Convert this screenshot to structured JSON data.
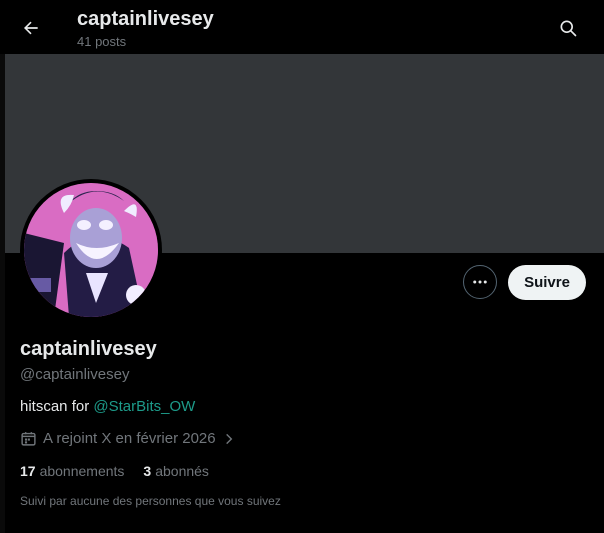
{
  "header": {
    "title": "captainlivesey",
    "subtitle": "41 posts",
    "back_icon": "arrow-left-icon",
    "search_icon": "search-icon"
  },
  "banner": {
    "color": "#333639"
  },
  "profile": {
    "display_name": "captainlivesey",
    "handle": "@captainlivesey",
    "bio_prefix": "hitscan for ",
    "bio_link": "@StarBits_OW",
    "joined": "A rejoint X en février 2026",
    "following_count": "17",
    "following_label": "abonnements",
    "followers_count": "3",
    "followers_label": "abonnés",
    "followed_by": "Suivi par aucune des personnes que vous suivez"
  },
  "actions": {
    "more_icon": "more-dots-icon",
    "follow_label": "Suivre"
  },
  "colors": {
    "background": "#000000",
    "text_primary": "#e7e9ea",
    "text_secondary": "#71767b",
    "link": "#1d9b8a",
    "button_bg": "#eff3f4"
  }
}
